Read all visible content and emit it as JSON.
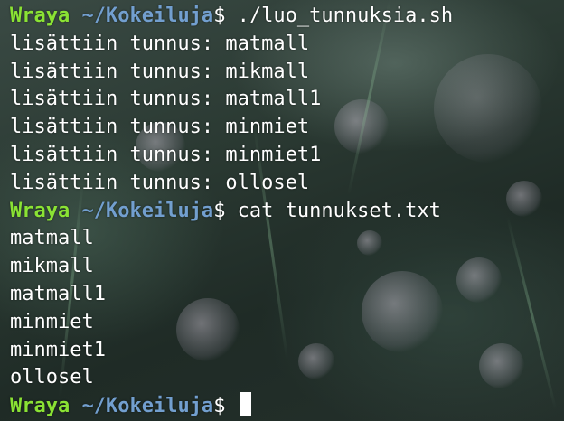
{
  "prompt": {
    "user": "Wraya",
    "path": "~/Kokeiluja",
    "symbol": "$"
  },
  "lines": [
    {
      "type": "prompt",
      "command": " ./luo_tunnuksia.sh"
    },
    {
      "type": "output",
      "text": "lisättiin tunnus: matmall"
    },
    {
      "type": "output",
      "text": "lisättiin tunnus: mikmall"
    },
    {
      "type": "output",
      "text": "lisättiin tunnus: matmall1"
    },
    {
      "type": "output",
      "text": "lisättiin tunnus: minmiet"
    },
    {
      "type": "output",
      "text": "lisättiin tunnus: minmiet1"
    },
    {
      "type": "output",
      "text": "lisättiin tunnus: ollosel"
    },
    {
      "type": "prompt",
      "command": " cat tunnukset.txt"
    },
    {
      "type": "output",
      "text": "matmall"
    },
    {
      "type": "output",
      "text": "mikmall"
    },
    {
      "type": "output",
      "text": "matmall1"
    },
    {
      "type": "output",
      "text": "minmiet"
    },
    {
      "type": "output",
      "text": "minmiet1"
    },
    {
      "type": "output",
      "text": "ollosel"
    },
    {
      "type": "prompt",
      "command": " "
    }
  ],
  "colors": {
    "user": "#8ae234",
    "path": "#729fcf",
    "text": "#ffffff"
  }
}
